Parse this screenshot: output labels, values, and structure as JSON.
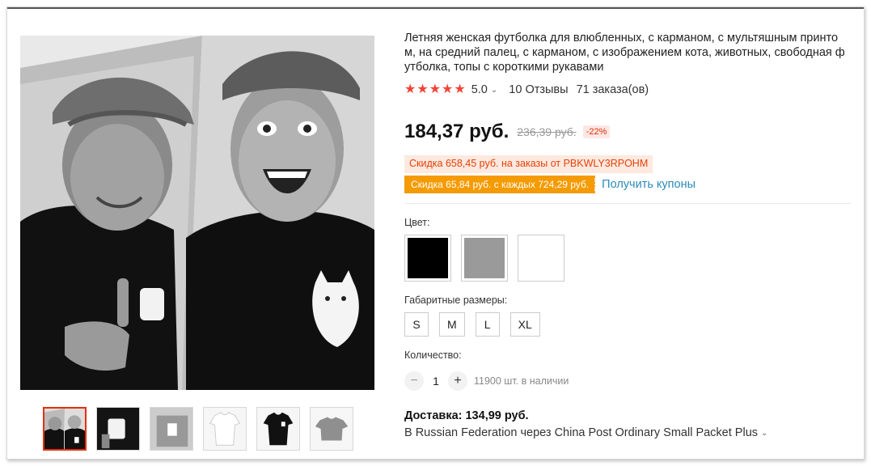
{
  "product": {
    "title": "Летняя женская футболка для влюбленных, с карманом, с мультяшным принто м, на средний палец, с карманом, с изображением кота, животных, свободная ф утболка, топы с короткими рукавами",
    "rating": {
      "stars": 5,
      "score": "5.0",
      "reviews": "10 Отзывы",
      "orders": "71 заказа(ов)"
    },
    "price": "184,37 руб.",
    "old_price": "236,39 руб.",
    "discount": "-22%",
    "coupons": {
      "store_discount": "Скидка 658,45 руб. на заказы от PBKWLY3RPOHM",
      "every_discount": "Скидка 65,84 руб. с каждых 724,29 руб.",
      "get_link": "Получить купоны"
    },
    "color_label": "Цвет:",
    "colors": [
      "#000000",
      "#9a9a9a",
      "#ffffff"
    ],
    "size_label": "Габаритные размеры:",
    "sizes": [
      "S",
      "M",
      "L",
      "XL"
    ],
    "quantity_label": "Количество:",
    "quantity": "1",
    "stock": "11900 шт. в наличии",
    "shipping": {
      "title": "Доставка: 134,99 руб.",
      "line": "В Russian Federation через China Post Ordinary Small Packet Plus"
    },
    "gallery": {
      "thumbs": [
        "photo-1",
        "photo-2",
        "photo-3",
        "white-shirt",
        "black-shirt",
        "grey-shirt"
      ],
      "active_index": 0
    },
    "icons": {
      "star": "star-icon",
      "chevron": "chevron-down-icon",
      "minus": "minus-icon",
      "plus": "plus-icon"
    }
  }
}
